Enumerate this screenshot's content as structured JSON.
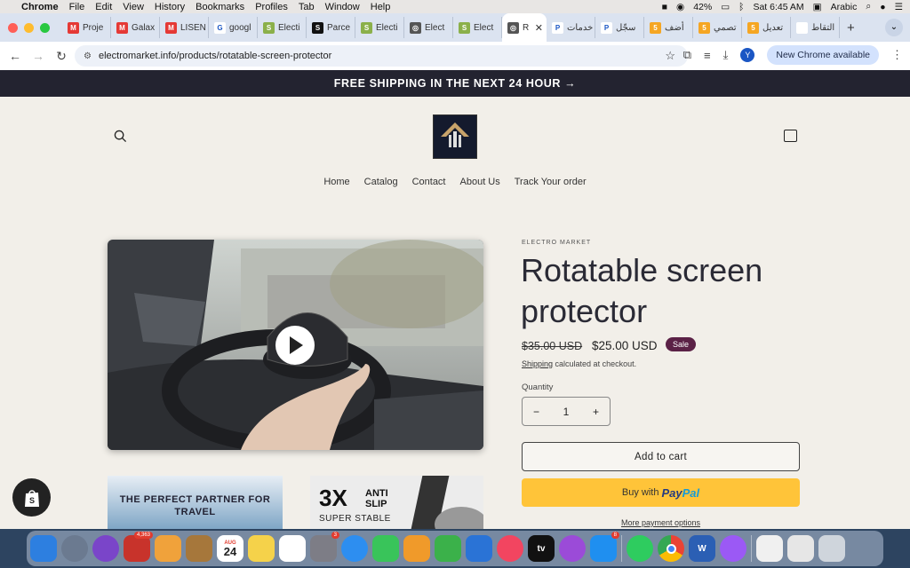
{
  "menubar": {
    "app": "Chrome",
    "items": [
      "File",
      "Edit",
      "View",
      "History",
      "Bookmarks",
      "Profiles",
      "Tab",
      "Window",
      "Help"
    ],
    "battery": "42%",
    "clock": "Sat 6:45 AM",
    "input_source": "Arabic"
  },
  "tabs": [
    {
      "label": "Proje",
      "color": "#e53935",
      "glyph": "M"
    },
    {
      "label": "Galax",
      "color": "#e53935",
      "glyph": "M"
    },
    {
      "label": "LISEN",
      "color": "#e53935",
      "glyph": "M"
    },
    {
      "label": "googl",
      "color": "#ffffff",
      "glyph": "G"
    },
    {
      "label": "Electi",
      "color": "#8bb04a",
      "glyph": "S"
    },
    {
      "label": "Parce",
      "color": "#111111",
      "glyph": "S"
    },
    {
      "label": "Electi",
      "color": "#8bb04a",
      "glyph": "S"
    },
    {
      "label": "Elect",
      "color": "#555555",
      "glyph": "◎"
    },
    {
      "label": "Elect",
      "color": "#8bb04a",
      "glyph": "S"
    },
    {
      "label": "R",
      "color": "#555555",
      "glyph": "◎",
      "active": true
    },
    {
      "label": "خدمات",
      "color": "#ffffff",
      "glyph": "P"
    },
    {
      "label": "سجّل",
      "color": "#ffffff",
      "glyph": "P"
    },
    {
      "label": "أضف",
      "color": "#f5a623",
      "glyph": "5"
    },
    {
      "label": "تصمي",
      "color": "#f5a623",
      "glyph": "5"
    },
    {
      "label": "تعديل",
      "color": "#f5a623",
      "glyph": "5"
    },
    {
      "label": "التقاط",
      "color": "#ffffff",
      "glyph": ""
    }
  ],
  "address": {
    "url": "electromarket.info/products/rotatable-screen-protector",
    "update_label": "New Chrome available",
    "avatar_letter": "Y"
  },
  "store": {
    "announcement": "FREE SHIPPING IN THE NEXT 24 HOUR →",
    "nav": [
      "Home",
      "Catalog",
      "Contact",
      "About Us",
      "Track Your order"
    ]
  },
  "product": {
    "vendor": "ELECTRO MARKET",
    "title": "Rotatable screen protector",
    "old_price": "$35.00 USD",
    "price": "$25.00 USD",
    "sale_badge": "Sale",
    "shipping_link": "Shipping",
    "shipping_text": " calculated at checkout.",
    "quantity_label": "Quantity",
    "quantity": "1",
    "minus": "−",
    "plus": "+",
    "add_to_cart": "Add to cart",
    "buy_with": "Buy with",
    "paypal_a": "Pay",
    "paypal_b": "Pal",
    "more_options": "More payment options",
    "thumb1_text": "THE PERFECT PARTNER FOR TRAVEL",
    "thumb2_big": "3X",
    "thumb2_small": "ANTI SLIP",
    "thumb2_sub": "SUPER STABLE"
  },
  "dock": [
    {
      "name": "finder",
      "color": "#2d7fe0",
      "badge": ""
    },
    {
      "name": "launchpad",
      "color": "#6b7a90",
      "badge": ""
    },
    {
      "name": "siri",
      "color": "#7a45c9",
      "badge": ""
    },
    {
      "name": "photo-app",
      "color": "#c8332b",
      "badge": "4,363"
    },
    {
      "name": "photos",
      "color": "#f0a23b",
      "badge": ""
    },
    {
      "name": "notes-brown",
      "color": "#a6773b",
      "badge": ""
    },
    {
      "name": "calendar",
      "color": "#ffffff",
      "badge": ""
    },
    {
      "name": "notes",
      "color": "#f5d24a",
      "badge": ""
    },
    {
      "name": "reminders",
      "color": "#ffffff",
      "badge": ""
    },
    {
      "name": "settings",
      "color": "#7d7d86",
      "badge": "3"
    },
    {
      "name": "messages-blue",
      "color": "#2d8ef0",
      "badge": ""
    },
    {
      "name": "facetime",
      "color": "#39c45a",
      "badge": ""
    },
    {
      "name": "pages",
      "color": "#f09a2a",
      "badge": ""
    },
    {
      "name": "numbers",
      "color": "#3bb14a",
      "badge": ""
    },
    {
      "name": "keynote",
      "color": "#2a73d6",
      "badge": ""
    },
    {
      "name": "music",
      "color": "#f24560",
      "badge": ""
    },
    {
      "name": "apple-tv",
      "color": "#111111",
      "badge": ""
    },
    {
      "name": "podcasts",
      "color": "#9b4bd8",
      "badge": ""
    },
    {
      "name": "app-store",
      "color": "#1f8ff0",
      "badge": "8"
    },
    {
      "name": "whatsapp",
      "color": "#2ecc5f",
      "badge": ""
    },
    {
      "name": "chrome",
      "color": "#e8e8e8",
      "badge": ""
    },
    {
      "name": "word",
      "color": "#2b5fb4",
      "badge": ""
    },
    {
      "name": "messenger",
      "color": "#9b59f5",
      "badge": ""
    },
    {
      "name": "preview",
      "color": "#f0f0f0",
      "badge": ""
    },
    {
      "name": "documents",
      "color": "#e6e6e6",
      "badge": ""
    },
    {
      "name": "trash",
      "color": "#cfd5dc",
      "badge": ""
    }
  ],
  "dock_labels": {
    "calendar_month": "AUG",
    "calendar_day": "24",
    "apple_tv": "tv",
    "word": "W"
  }
}
